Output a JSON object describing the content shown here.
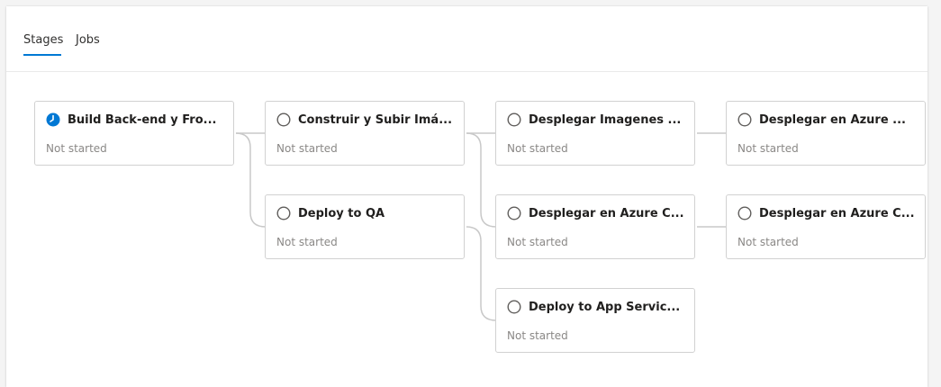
{
  "tabs": {
    "stages": "Stages",
    "jobs": "Jobs"
  },
  "colors": {
    "accent": "#0078d4",
    "connector": "#c8c8c8",
    "status_text": "#8a8886"
  },
  "stages": [
    {
      "title": "Build Back-end y Fro...",
      "status": "Not started",
      "icon": "clock-icon"
    },
    {
      "title": "Construir y Subir Imá...",
      "status": "Not started",
      "icon": "circle-icon"
    },
    {
      "title": "Deploy to QA",
      "status": "Not started",
      "icon": "circle-icon"
    },
    {
      "title": "Desplegar Imagenes ...",
      "status": "Not started",
      "icon": "circle-icon"
    },
    {
      "title": "Desplegar en Azure C...",
      "status": "Not started",
      "icon": "circle-icon"
    },
    {
      "title": "Deploy to App Servic...",
      "status": "Not started",
      "icon": "circle-icon"
    },
    {
      "title": "Desplegar en Azure ...",
      "status": "Not started",
      "icon": "circle-icon"
    },
    {
      "title": "Desplegar en Azure C...",
      "status": "Not started",
      "icon": "circle-icon"
    }
  ]
}
